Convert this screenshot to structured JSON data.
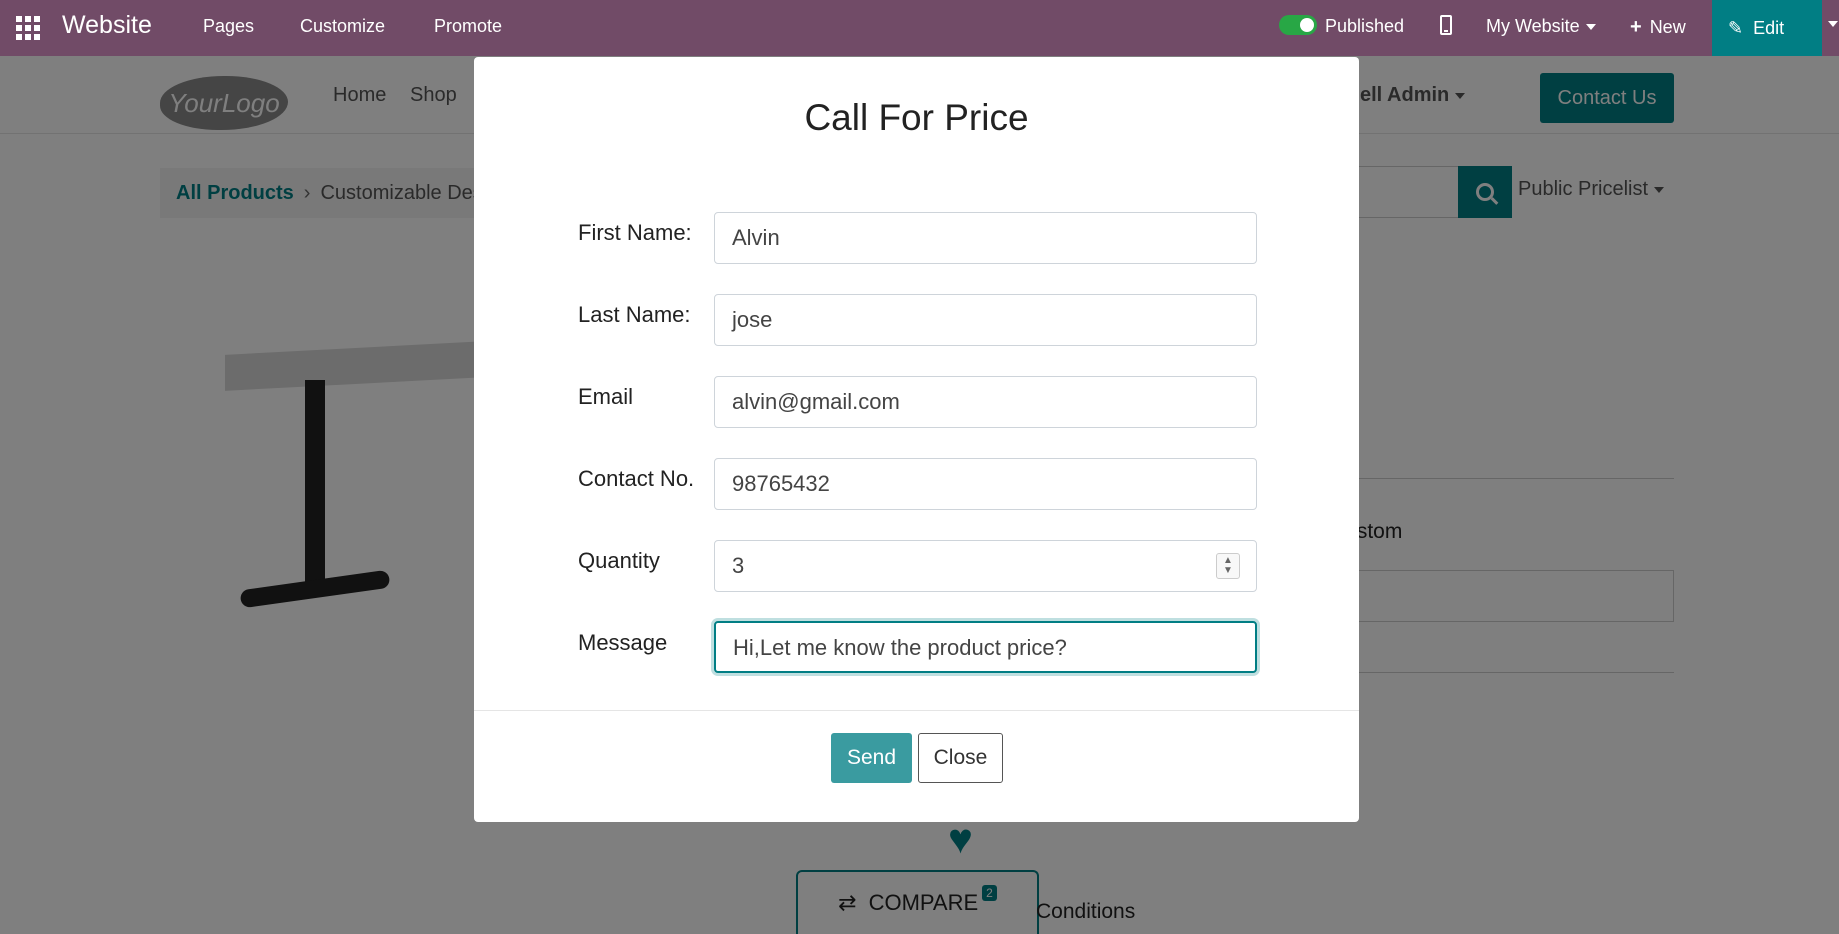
{
  "topbar": {
    "brand": "Website",
    "nav": [
      "Pages",
      "Customize",
      "Promote"
    ],
    "published_label": "Published",
    "my_website_label": "My Website",
    "new_label": "New",
    "edit_label": "Edit"
  },
  "site": {
    "logo_text": "YourLogo",
    "nav": [
      "Home",
      "Shop"
    ],
    "admin_label": "tchell Admin",
    "contact_label": "Contact Us"
  },
  "product": {
    "breadcrumb_all": "All Products",
    "breadcrumb_current": "Customizable Desk",
    "pricelist_label": "Public Pricelist",
    "custom_label": "Custom",
    "compare_label": "COMPARE",
    "compare_count": "2",
    "conditions_label": "Conditions"
  },
  "modal": {
    "title": "Call For Price",
    "fields": {
      "first_name": {
        "label": "First Name:",
        "value": "Alvin"
      },
      "last_name": {
        "label": "Last Name:",
        "value": "jose"
      },
      "email": {
        "label": "Email",
        "value": "alvin@gmail.com"
      },
      "contact": {
        "label": "Contact No.",
        "value": "98765432"
      },
      "quantity": {
        "label": "Quantity",
        "value": "3"
      },
      "message": {
        "label": "Message",
        "value": "Hi,Let me know the product price?"
      }
    },
    "send_label": "Send",
    "close_label": "Close"
  },
  "colors": {
    "topbar": "#714b67",
    "accent": "#017e84",
    "toggle_on": "#28a745"
  }
}
